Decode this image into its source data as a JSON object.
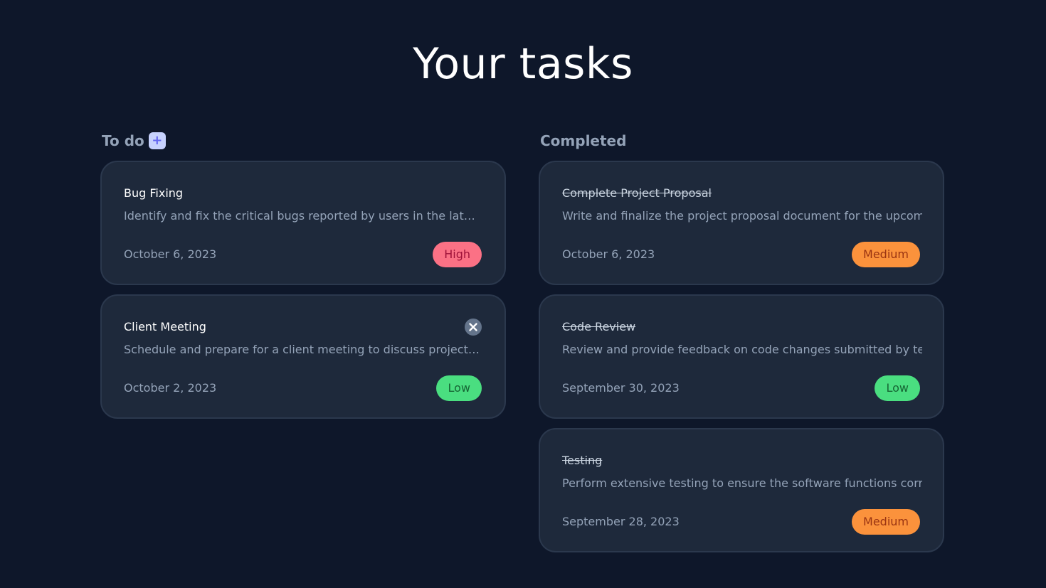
{
  "page": {
    "title": "Your tasks"
  },
  "todo": {
    "label": "To do",
    "add_icon": "plus-icon",
    "add_symbol": "+",
    "cards": [
      {
        "title": "Bug Fixing",
        "description": "Identify and fix the critical bugs reported by users in the latest software release",
        "date": "October 6, 2023",
        "priority": "High",
        "priority_bg": "#fb7185",
        "priority_fg": "#9f1239"
      },
      {
        "title": "Client Meeting",
        "description": "Schedule and prepare for a client meeting to discuss project progress and requirements",
        "date": "October 2, 2023",
        "priority": "Low",
        "priority_bg": "#4ade80",
        "priority_fg": "#166534",
        "close_icon": "close-icon"
      }
    ]
  },
  "completed": {
    "label": "Completed",
    "cards": [
      {
        "title": "Complete Project Proposal",
        "description": "Write and finalize the project proposal document for the upcoming",
        "date": "October 6, 2023",
        "priority": "Medium",
        "priority_bg": "#fb923c",
        "priority_fg": "#9a3412"
      },
      {
        "title": "Code Review",
        "description": "Review and provide feedback on code changes submitted by team",
        "date": "September 30, 2023",
        "priority": "Low",
        "priority_bg": "#4ade80",
        "priority_fg": "#166534"
      },
      {
        "title": "Testing",
        "description": "Perform extensive testing to ensure the software functions correct",
        "date": "September 28, 2023",
        "priority": "Medium",
        "priority_bg": "#fb923c",
        "priority_fg": "#9a3412"
      }
    ]
  },
  "colors": {
    "background": "#0e172a",
    "card": "#1e293b",
    "card_border": "#2b384d",
    "muted_text": "#94a3b8",
    "accent": "#6366f1"
  }
}
